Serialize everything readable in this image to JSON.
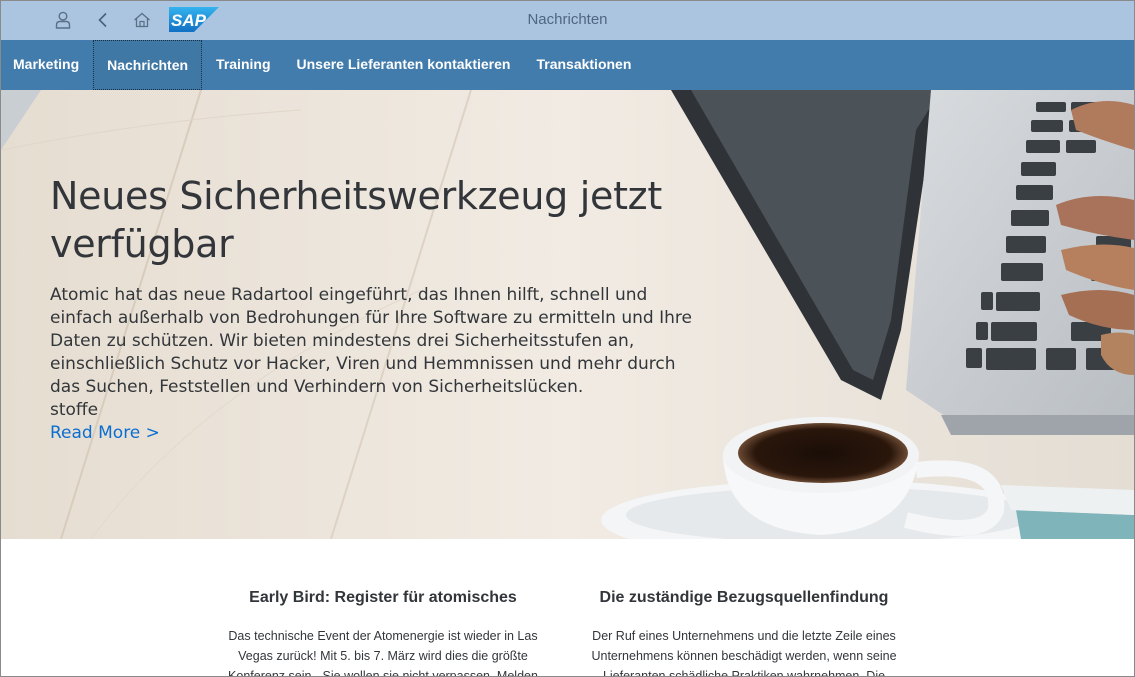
{
  "shell": {
    "title": "Nachrichten",
    "logo_text": "SAP",
    "icons": [
      "user-icon",
      "back-icon",
      "home-icon"
    ]
  },
  "nav": {
    "items": [
      {
        "label": "Marketing",
        "active": false
      },
      {
        "label": "Nachrichten",
        "active": true
      },
      {
        "label": "Training",
        "active": false
      },
      {
        "label": "Unsere Lieferanten kontaktieren",
        "active": false
      },
      {
        "label": "Transaktionen",
        "active": false
      }
    ]
  },
  "hero": {
    "title": "Neues Sicherheitswerkzeug jetzt verfügbar",
    "body": "Atomic hat das neue Radartool eingeführt, das Ihnen hilft, schnell und einfach außerhalb von Bedrohungen für Ihre Software zu ermitteln und Ihre Daten zu schützen. Wir bieten mindestens drei Sicherheitsstufen an, einschließlich Schutz vor Hacker, Viren und Hemmnissen und mehr durch das Suchen, Feststellen und Verhindern von Sicherheitslücken.",
    "extra": "stoffe",
    "link_label": "Read More >"
  },
  "cards": [
    {
      "title": "Early Bird: Register für atomisches",
      "text": "Das technische Event der Atomenergie ist wieder in Las Vegas zurück! Mit 5. bis 7. März wird dies die größte Konferenz sein - Sie wollen sie nicht verpassen. Melden"
    },
    {
      "title": "Die zuständige Bezugsquellenfindung",
      "text": "Der Ruf eines Unternehmens und die letzte Zeile eines Unternehmens können beschädigt werden, wenn seine Lieferanten schädliche Praktiken wahrnehmen. Die"
    }
  ],
  "colors": {
    "shellbar": "#abc5e0",
    "navbar": "#427cac",
    "link": "#0a6ed1",
    "sap_blue": "#1a8fd8"
  }
}
